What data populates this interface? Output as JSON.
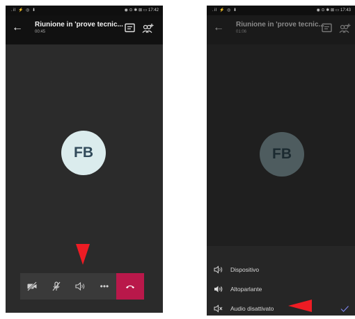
{
  "left_screen": {
    "status": {
      "left": ".il ⚡ ◎ ⬇",
      "right": "◉ ⊙ ✱ ⊠ ▭ 17:42"
    },
    "header": {
      "title": "Riunione in 'prove tecnic...",
      "duration": "00:45"
    },
    "avatar": {
      "initials": "FB"
    },
    "call_controls": [
      {
        "name": "camera-off",
        "icon": "camera-off-icon"
      },
      {
        "name": "mic-muted",
        "icon": "mic-off-icon"
      },
      {
        "name": "audio-output",
        "icon": "speaker-icon"
      },
      {
        "name": "more",
        "icon": "more-icon",
        "label": "•••"
      },
      {
        "name": "hang-up",
        "icon": "hang-up-icon"
      }
    ]
  },
  "right_screen": {
    "status": {
      "left": ".il ⚡ ◎ ⬇",
      "right": "◉ ⊙ ✱ ⊠ ▭ 17:43"
    },
    "header": {
      "title": "Riunione in 'prove tecnic...",
      "duration": "01:06"
    },
    "avatar": {
      "initials": "FB"
    },
    "audio_options": [
      {
        "label": "Dispositivo",
        "icon": "speaker-outline-icon",
        "selected": false
      },
      {
        "label": "Altoparlante",
        "icon": "speaker-filled-icon",
        "selected": false
      },
      {
        "label": "Audio disattivato",
        "icon": "speaker-muted-icon",
        "selected": true
      }
    ]
  },
  "colors": {
    "arrow": "#ee1c24",
    "hang_up": "#b9184a",
    "check": "#7b83eb"
  }
}
